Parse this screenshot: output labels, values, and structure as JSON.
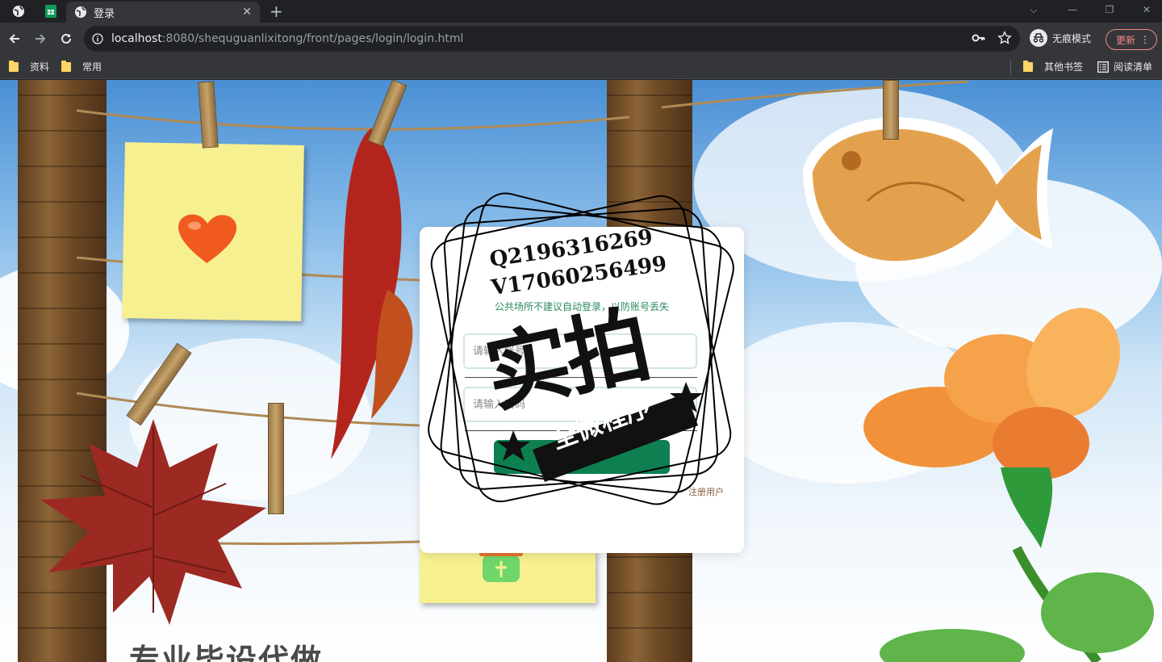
{
  "browser": {
    "tab_title": "登录",
    "url_host": "localhost",
    "url_rest": ":8080/shequguanlixitong/front/pages/login/login.html",
    "incognito_label": "无痕模式",
    "update_label": "更新",
    "bookmarks": [
      {
        "label": "资料"
      },
      {
        "label": "常用"
      },
      {
        "label": "其他书签"
      },
      {
        "label": "阅读清单"
      }
    ]
  },
  "login": {
    "hint": "公共场所不建议自动登录，以防账号丢失",
    "username_placeholder": "请输入账号",
    "password_placeholder": "请输入密码",
    "submit_label": "登录",
    "register_label": "注册用户"
  },
  "watermark": {
    "line1": "Q2196316269",
    "line2": "V17060256499",
    "big": "实拍",
    "ribbon": "全微程序"
  },
  "background": {
    "headline": "专业毕设代做"
  },
  "colors": {
    "accent": "#0e7f50",
    "hint": "#2c8a60"
  }
}
